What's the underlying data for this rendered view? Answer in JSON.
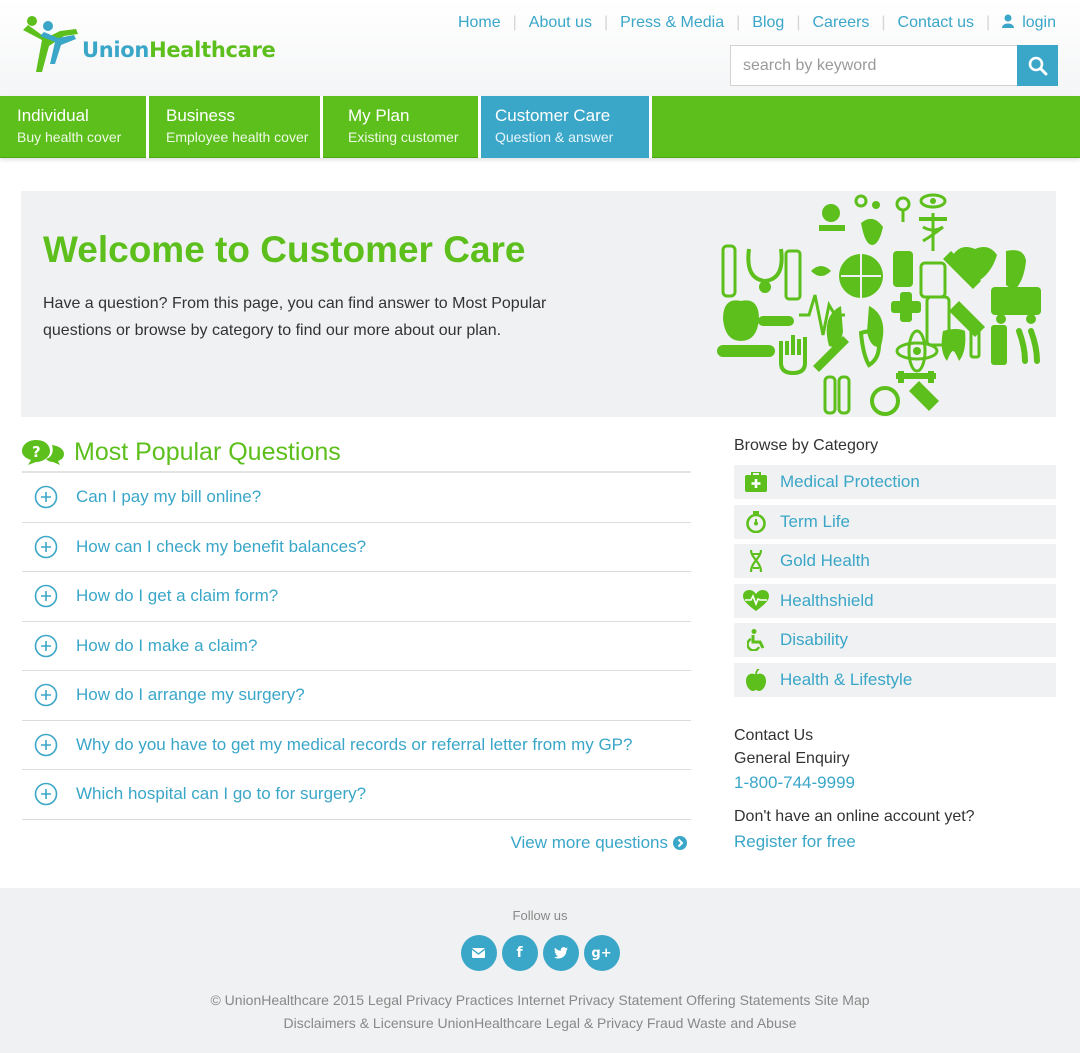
{
  "brand": {
    "part1": "Union",
    "part2": "Healthcare"
  },
  "topnav": {
    "links": [
      "Home",
      "About us",
      "Press & Media",
      "Blog",
      "Careers",
      "Contact us"
    ],
    "login": "login"
  },
  "search": {
    "placeholder": "search by keyword"
  },
  "mainnav": [
    {
      "title": "Individual",
      "sub": "Buy health cover"
    },
    {
      "title": "Business",
      "sub": "Employee health cover"
    },
    {
      "title": "My Plan",
      "sub": "Existing customer"
    },
    {
      "title": "Customer Care",
      "sub": "Question & answer"
    }
  ],
  "hero": {
    "title": "Welcome to Customer Care",
    "text": "Have a question? From this page, you can find answer to Most Popular questions or browse by category to find our more about our plan."
  },
  "questions": {
    "heading": "Most Popular Questions",
    "items": [
      "Can I pay my bill online?",
      "How can I check my benefit balances?",
      "How do I get a claim form?",
      "How do I make a claim?",
      "How do I arrange my surgery?",
      "Why do you have to get my medical records or referral letter from my GP?",
      "Which hospital can I go to for surgery?"
    ],
    "view_more": "View more questions"
  },
  "categories": {
    "heading": "Browse by Category",
    "items": [
      {
        "label": "Medical Protection",
        "icon": "first-aid-kit-icon"
      },
      {
        "label": "Term Life",
        "icon": "stopwatch-icon"
      },
      {
        "label": "Gold Health",
        "icon": "dna-icon"
      },
      {
        "label": "Healthshield",
        "icon": "heartbeat-icon"
      },
      {
        "label": "Disability",
        "icon": "wheelchair-icon"
      },
      {
        "label": "Health & Lifestyle",
        "icon": "apple-icon"
      }
    ]
  },
  "contact": {
    "heading": "Contact Us",
    "enquiry": "General Enquiry",
    "phone": "1-800-744-9999",
    "no_account": "Don't have an online account yet?",
    "register": "Register for free"
  },
  "footer": {
    "follow": "Follow us",
    "line1": "© UnionHealthcare 2015 Legal Privacy Practices Internet Privacy Statement Offering Statements Site Map",
    "line2": "Disclaimers & Licensure UnionHealthcare Legal & Privacy Fraud Waste and Abuse"
  },
  "colors": {
    "green": "#5cbf1c",
    "blue": "#3aa6c8",
    "panel": "#f0f1f2"
  }
}
